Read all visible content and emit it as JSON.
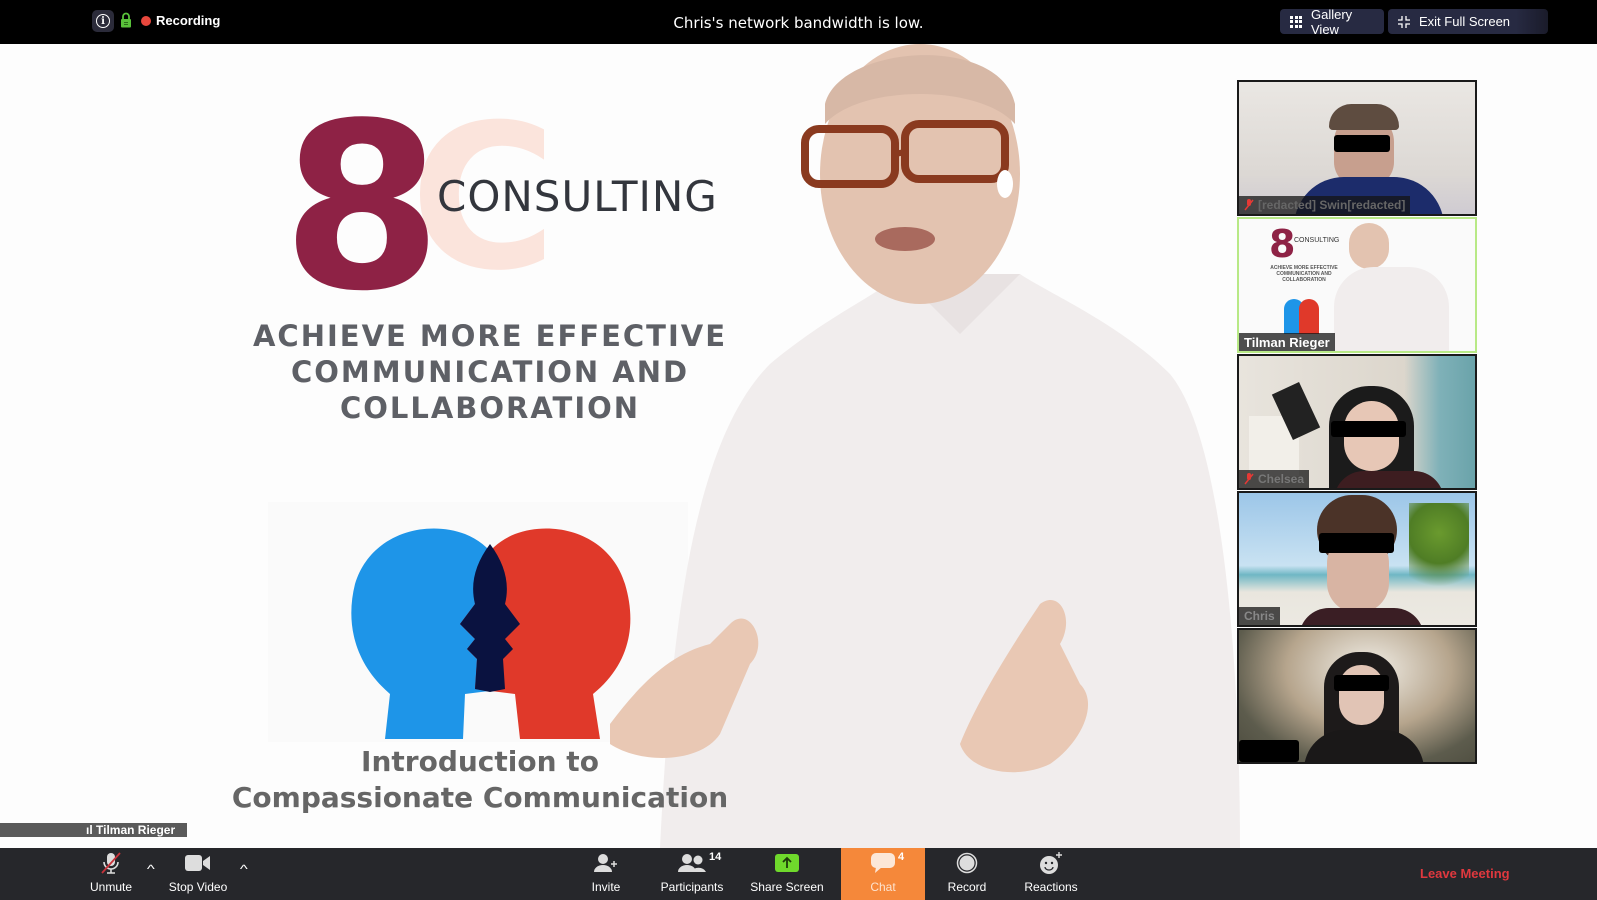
{
  "topbar": {
    "recording_label": "Recording",
    "notice": "Chris's network bandwidth is low.",
    "gallery_view_label": "Gallery View",
    "exit_fullscreen_label": "Exit Full Screen",
    "recording_color": "#e8483d",
    "lock_color": "#59c13a"
  },
  "slide": {
    "logo_number": "8",
    "logo_letter": "C",
    "logo_text": "CONSULTING",
    "tagline_lines": [
      "ACHIEVE MORE EFFECTIVE",
      "COMMUNICATION AND",
      "COLLABORATION"
    ],
    "course_lines": [
      "Introduction to",
      "Compassionate Communication"
    ],
    "brand_color": "#8e2245"
  },
  "active_speaker": {
    "name": "Tilman Rieger"
  },
  "participants": [
    {
      "name": "[redacted] Swin[redacted]",
      "muted": true,
      "active": false
    },
    {
      "name": "Tilman Rieger",
      "muted": false,
      "active": true
    },
    {
      "name": "Chelsea",
      "muted": true,
      "active": false
    },
    {
      "name": "Chris",
      "muted": false,
      "active": false
    },
    {
      "name": "[redacted]",
      "muted": false,
      "active": false
    }
  ],
  "toolbar": {
    "unmute_label": "Unmute",
    "stop_video_label": "Stop Video",
    "invite_label": "Invite",
    "participants_label": "Participants",
    "participants_count": "14",
    "share_screen_label": "Share Screen",
    "chat_label": "Chat",
    "chat_count": "4",
    "record_label": "Record",
    "reactions_label": "Reactions",
    "leave_label": "Leave Meeting",
    "chat_color": "#f5883a",
    "share_color": "#6fd92c",
    "leave_color": "#e0383e"
  }
}
